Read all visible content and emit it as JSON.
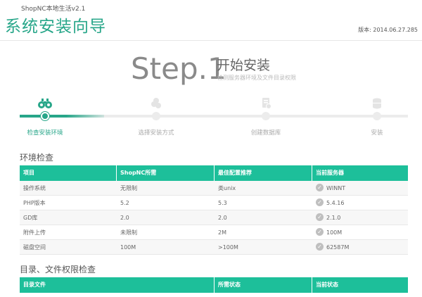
{
  "header": {
    "product": "ShopNC本地生活v2.1",
    "title": "系统安装向导",
    "version": "版本: 2014.06.27.285"
  },
  "step_heading": {
    "number": "Step.1",
    "name": "开始安装",
    "description": "检测服务器环境及文件目录权限"
  },
  "steps": [
    {
      "label": "检查安装环境",
      "icon": "binoculars-icon",
      "active": true
    },
    {
      "label": "选择安装方式",
      "icon": "stack-icon",
      "active": false
    },
    {
      "label": "创建数据库",
      "icon": "database-icon",
      "active": false
    },
    {
      "label": "安装",
      "icon": "install-icon",
      "active": false
    }
  ],
  "env_section": {
    "title": "环境检查",
    "headers": [
      "项目",
      "ShopNC所需",
      "最佳配置推荐",
      "当前服务器"
    ],
    "rows": [
      {
        "item": "操作系统",
        "required": "无限制",
        "recommended": "类unix",
        "current": "WINNT"
      },
      {
        "item": "PHP版本",
        "required": "5.2",
        "recommended": "5.3",
        "current": "5.4.16"
      },
      {
        "item": "GD库",
        "required": "2.0",
        "recommended": "2.0",
        "current": "2.1.0"
      },
      {
        "item": "附件上传",
        "required": "未限制",
        "recommended": "2M",
        "current": "100M"
      },
      {
        "item": "磁盘空间",
        "required": "100M",
        "recommended": ">100M",
        "current": "62587M"
      }
    ]
  },
  "dir_section": {
    "title": "目录、文件权限检查",
    "headers": [
      "目录文件",
      "所需状态",
      "当前状态"
    ]
  },
  "colors": {
    "accent": "#27a689",
    "table_header": "#1dbf9a",
    "check": "#bfbfbf"
  }
}
